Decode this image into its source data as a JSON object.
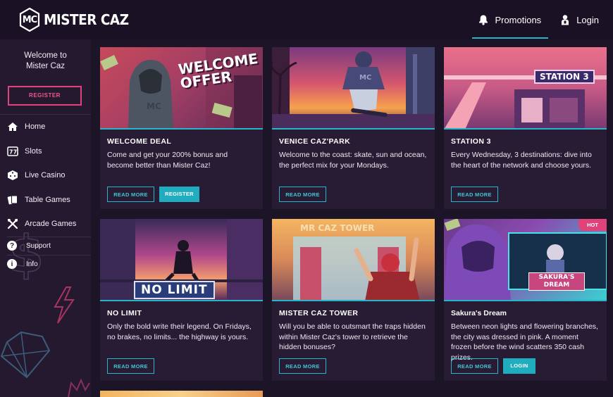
{
  "header": {
    "logo_badge": "MC",
    "logo_text": "MISTER CAZ",
    "nav": {
      "promotions": "Promotions",
      "login": "Login"
    }
  },
  "sidebar": {
    "welcome_line1": "Welcome to",
    "welcome_line2": "Mister Caz",
    "register": "REGISTER",
    "items": [
      {
        "label": "Home",
        "icon": "home-icon"
      },
      {
        "label": "Slots",
        "icon": "slots-icon"
      },
      {
        "label": "Live Casino",
        "icon": "dice-icon"
      },
      {
        "label": "Table Games",
        "icon": "cards-icon"
      },
      {
        "label": "Arcade Games",
        "icon": "joystick-icon"
      }
    ],
    "secondary": [
      {
        "label": "Support",
        "icon": "question-icon"
      },
      {
        "label": "Info",
        "icon": "info-icon"
      }
    ]
  },
  "cards": [
    {
      "title": "WELCOME DEAL",
      "desc": "Come and get your 200% bonus and become better than Mister Caz!",
      "image_text": "WELCOME OFFER",
      "buttons": [
        "READ MORE",
        "REGISTER"
      ]
    },
    {
      "title": "VENICE CAZ'PARK",
      "desc": "Welcome to the coast: skate, sun and ocean, the perfect mix for your Mondays.",
      "buttons": [
        "READ MORE"
      ]
    },
    {
      "title": "STATION 3",
      "desc": "Every Wednesday, 3 destinations: dive into the heart of the network and choose yours.",
      "image_text": "STATION 3",
      "buttons": [
        "READ MORE"
      ]
    },
    {
      "title": "NO LIMIT",
      "desc": "Only the bold write their legend. On Fridays, no brakes, no limits... the highway is yours.",
      "image_text": "NO LIMIT",
      "buttons": [
        "READ MORE"
      ]
    },
    {
      "title": "MISTER CAZ TOWER",
      "desc": "Will you be able to outsmart the traps hidden within Mister Caz's tower to retrieve the hidden bonuses?",
      "image_text": "MR CAZ TOWER",
      "buttons": [
        "READ MORE"
      ]
    },
    {
      "title": "Sakura's Dream",
      "desc": "Between neon lights and flowering branches, the city was dressed in pink. A moment frozen before the wind scatters 350 cash prizes.",
      "image_text": "SAKURA'S DREAM",
      "badge": "HOT",
      "buttons": [
        "READ MORE",
        "LOGIN"
      ]
    }
  ],
  "colors": {
    "accent": "#25b7c9",
    "pink": "#e0427a",
    "bg": "#1c1427"
  }
}
